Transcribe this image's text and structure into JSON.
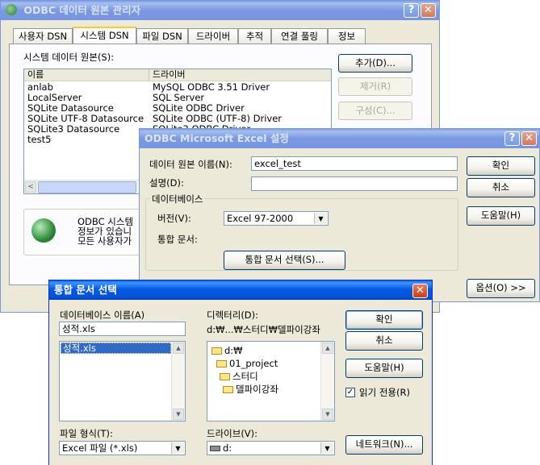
{
  "admin": {
    "title": "ODBC 데이터 원본 관리자",
    "help_glyph": "?",
    "close_glyph": "✕",
    "tabs": [
      "사용자 DSN",
      "시스템 DSN",
      "파일 DSN",
      "드라이버",
      "추적",
      "연결 풀링",
      "정보"
    ],
    "section_label": "시스템 데이터 원본(S):",
    "col_name": "이름",
    "col_driver": "드라이버",
    "rows": [
      {
        "name": "anlab",
        "driver": "MySQL ODBC 3.51 Driver"
      },
      {
        "name": "LocalServer",
        "driver": "SQL Server"
      },
      {
        "name": "SQLite Datasource",
        "driver": "SQLite ODBC Driver"
      },
      {
        "name": "SQLite UTF-8 Datasource",
        "driver": "SQLite ODBC (UTF-8) Driver"
      },
      {
        "name": "SQLite3 Datasource",
        "driver": "SQLite3 ODBC Driver"
      },
      {
        "name": "test5",
        "driver": ""
      }
    ],
    "add_button": "추가(D)...",
    "remove_button": "제거(R)",
    "configure_button": "구성(C)...",
    "info_line1": "ODBC 시스템",
    "info_line2": "정보가 있습니",
    "info_line3": "모든 사용자가",
    "scroll_left": "<"
  },
  "excel_setup": {
    "title": "ODBC Microsoft Excel 설정",
    "help_glyph": "?",
    "close_glyph": "✕",
    "dsn_label": "데이터 원본 이름(N):",
    "dsn_value": "excel_test",
    "desc_label": "설명(D):",
    "desc_value": "",
    "db_group": "데이터베이스",
    "version_label": "버전(V):",
    "version_value": "Excel 97-2000",
    "workbook_label": "통합 문서:",
    "select_workbook_button": "통합 문서 선택(S)...",
    "ok_button": "확인",
    "cancel_button": "취소",
    "help_button": "도움말(H)",
    "options_button": "옵션(O) >>"
  },
  "select_workbook": {
    "title": "통합 문서 선택",
    "close_glyph": "✕",
    "db_name_label": "데이터베이스 이름(A)",
    "db_name_value": "성적.xls",
    "files": [
      "성적.xls"
    ],
    "dir_label": "디렉터리(D):",
    "dir_path": "d:₩...₩스터디₩델파이강좌",
    "dirs": [
      "d:₩",
      "01_project",
      "스터디",
      "델파이강좌"
    ],
    "filetype_label": "파일 형식(T):",
    "filetype_value": "Excel 파일 (*.xls)",
    "drive_label": "드라이브(V):",
    "drive_value": "d:",
    "ok_button": "확인",
    "cancel_button": "취소",
    "help_button": "도움말(H)",
    "readonly_label": "읽기 전용(R)",
    "readonly_checked": "✓",
    "network_button": "네트워크(N)...",
    "arrow_up": "▲",
    "arrow_down": "▼"
  }
}
